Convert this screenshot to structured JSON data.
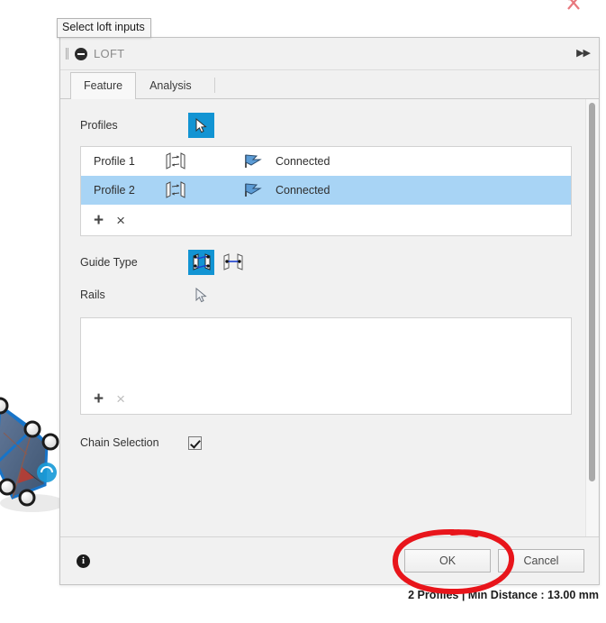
{
  "tooltip": {
    "text": "Select loft inputs"
  },
  "dialog": {
    "title": "LOFT",
    "collapse_icon": "minus-circle-icon",
    "grip_icon": "drag-grip-icon",
    "expand_icon": "double-chevron-right-icon",
    "tabs": [
      {
        "label": "Feature",
        "active": true
      },
      {
        "label": "Analysis",
        "active": false
      }
    ],
    "profiles": {
      "label": "Profiles",
      "select_button_icon": "cursor-arrow-icon",
      "select_button_active": true,
      "rows": [
        {
          "name": "Profile 1",
          "profile_icon": "loft-profile-icon",
          "condition_icon": "connected-flag-icon",
          "condition": "Connected",
          "selected": false
        },
        {
          "name": "Profile 2",
          "profile_icon": "loft-profile-icon",
          "condition_icon": "connected-flag-icon",
          "condition": "Connected",
          "selected": true
        }
      ],
      "add_label": "+",
      "remove_label": "×"
    },
    "guide_type": {
      "label": "Guide Type",
      "options": [
        {
          "icon": "rails-guide-icon",
          "selected": true
        },
        {
          "icon": "centerline-guide-icon",
          "selected": false
        }
      ]
    },
    "rails": {
      "label": "Rails",
      "select_button_icon": "cursor-arrow-icon",
      "select_button_active": false,
      "add_label": "+",
      "remove_label": "×"
    },
    "chain_selection": {
      "label": "Chain Selection",
      "checked": true
    },
    "footer": {
      "info_icon": "info-icon",
      "info_glyph": "i",
      "ok_label": "OK",
      "cancel_label": "Cancel"
    }
  },
  "status": {
    "text": "2 Profiles | Min Distance : 13.00 mm"
  },
  "annotation": {
    "shape": "red-ellipse-highlight",
    "color": "#e8151b"
  },
  "colors": {
    "accent_blue": "#1294d3",
    "selection_blue": "#a8d4f5",
    "panel_bg": "#f1f1f1",
    "annotation_red": "#e8151b"
  }
}
